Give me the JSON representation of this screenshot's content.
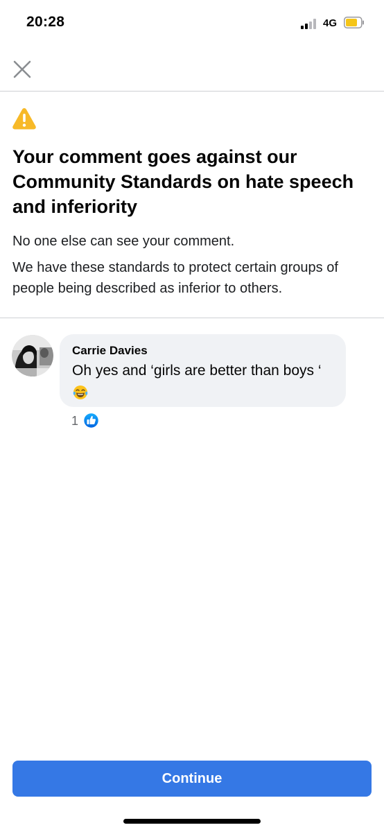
{
  "status_bar": {
    "time": "20:28",
    "network": "4G",
    "icons": [
      "signal-icon",
      "battery-icon"
    ],
    "battery_color": "#f5c518"
  },
  "header": {
    "close_icon": "close-icon"
  },
  "warning": {
    "icon": "warning-icon",
    "icon_color": "#f7b928",
    "headline": "Your comment goes against our Community Standards on hate speech and inferiority",
    "paragraph1": "No one else can see your comment.",
    "paragraph2": "We have these standards to protect certain groups of people being described as inferior to others."
  },
  "comment": {
    "author": "Carrie Davies",
    "text": "Oh yes and ‘girls are better than boys ‘",
    "emoji": "face-with-tears-of-joy-icon",
    "reaction_count": "1",
    "reaction_icon": "like-icon",
    "bubble_color": "#f0f2f5"
  },
  "footer": {
    "continue_label": "Continue",
    "button_color": "#3578e5"
  }
}
